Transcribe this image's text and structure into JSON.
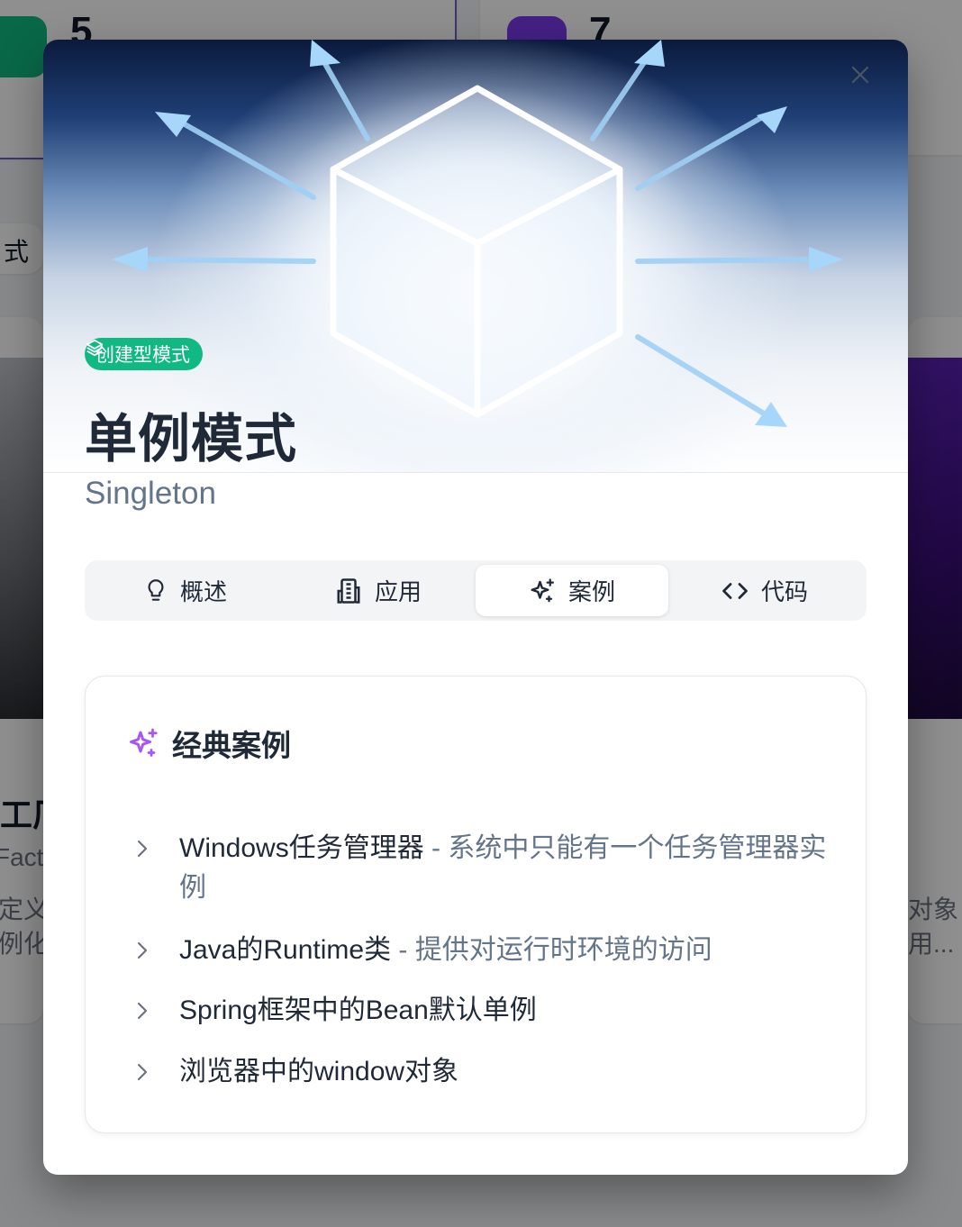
{
  "background": {
    "stats": [
      {
        "value": "5"
      },
      {
        "value": "7"
      }
    ],
    "snippets": {
      "left_tag": "式",
      "left_title": "工厂",
      "left_en": "Facto",
      "left_line1": "定义-",
      "left_line2": "例化吗",
      "right_line1": "对象",
      "right_line2": "用..."
    }
  },
  "modal": {
    "close_icon": "close-icon",
    "category_badge": {
      "icon": "layers-icon",
      "label": "创建型模式",
      "color": "#10b981"
    },
    "title": "单例模式",
    "subtitle": "Singleton",
    "tabs": [
      {
        "icon": "lightbulb-icon",
        "label": "概述",
        "active": false
      },
      {
        "icon": "building-icon",
        "label": "应用",
        "active": false
      },
      {
        "icon": "sparkles-icon",
        "label": "案例",
        "active": true
      },
      {
        "icon": "code-icon",
        "label": "代码",
        "active": false
      }
    ],
    "cases": {
      "icon": "sparkles-icon",
      "accent_color": "#a855f7",
      "title": "经典案例",
      "items": [
        {
          "name": "Windows任务管理器",
          "sep": " - ",
          "desc": "系统中只能有一个任务管理器实例"
        },
        {
          "name": "Java的Runtime类",
          "sep": " - ",
          "desc": "提供对运行时环境的访问"
        },
        {
          "name": "Spring框架中的Bean默认单例",
          "sep": "",
          "desc": ""
        },
        {
          "name": "浏览器中的window对象",
          "sep": "",
          "desc": ""
        }
      ]
    }
  }
}
